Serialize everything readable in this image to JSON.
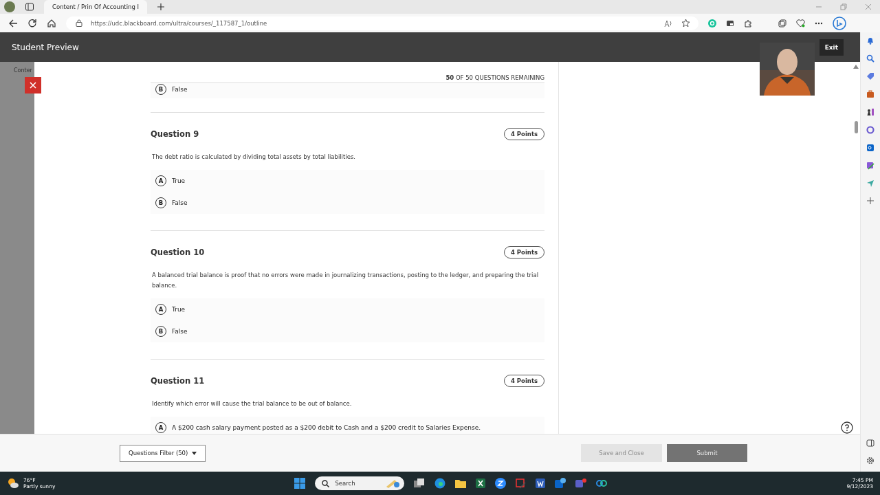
{
  "browser": {
    "tabs": [
      {
        "title": "Content / Prin Of Accounting I",
        "selected": true
      }
    ],
    "url": "https://udc.blackboard.com/ultra/courses/_117587_1/outline"
  },
  "header": {
    "title": "Student Preview",
    "exit": "Exit"
  },
  "side": {
    "tab": "Conter"
  },
  "progress": {
    "text": "**50** OF 50 QUESTIONS REMAINING"
  },
  "previous_option": {
    "letter": "B",
    "text": "False"
  },
  "questions": [
    {
      "title": "Question 9",
      "points": "4 Points",
      "prompt": "The debt ratio is calculated by dividing total assets by total liabilities.",
      "options": [
        {
          "letter": "A",
          "text": "True"
        },
        {
          "letter": "B",
          "text": "False"
        }
      ]
    },
    {
      "title": "Question 10",
      "points": "4 Points",
      "prompt": "A balanced trial balance is proof that no errors were made in journalizing transactions, posting to the ledger, and preparing the trial balance.",
      "options": [
        {
          "letter": "A",
          "text": "True"
        },
        {
          "letter": "B",
          "text": "False"
        }
      ]
    },
    {
      "title": "Question 11",
      "points": "4 Points",
      "prompt": "Identify which error will cause the trial balance to be out of balance.",
      "options": [
        {
          "letter": "A",
          "text": "A $200 cash salary payment posted as a $200 debit to Cash and a $200 credit to Salaries Expense."
        }
      ]
    }
  ],
  "footer": {
    "filter": "Questions Filter (50)",
    "save": "Save and Close",
    "submit": "Submit"
  },
  "taskbar": {
    "temperature": "76°F",
    "condition": "Partly sunny",
    "search": "Search",
    "time": "7:45 PM",
    "date": "9/12/2023"
  }
}
